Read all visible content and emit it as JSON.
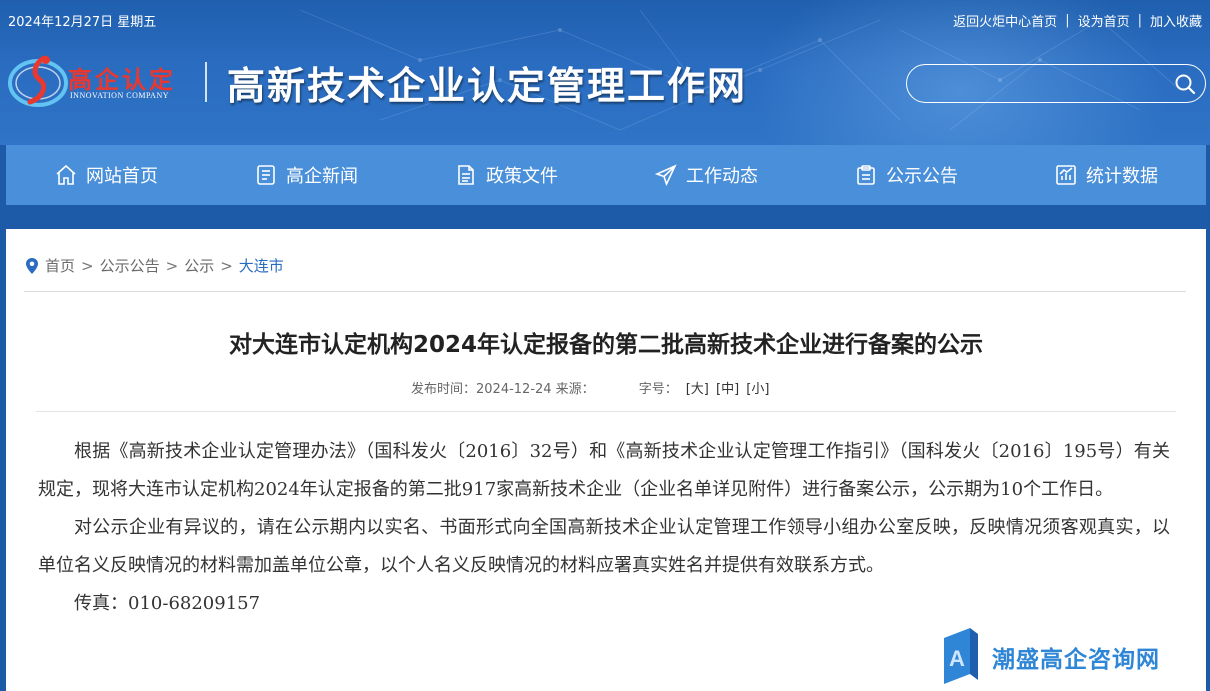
{
  "topbar": {
    "date": "2024年12月27日 星期五",
    "links": [
      "返回火炬中心首页",
      "设为首页",
      "加入收藏"
    ],
    "separator": "|"
  },
  "logo": {
    "cn": "高企认定",
    "en": "INNOVATION COMPANY"
  },
  "site_title": "高新技术企业认定管理工作网",
  "search": {
    "placeholder": ""
  },
  "nav": [
    {
      "label": "网站首页",
      "icon": "home-icon"
    },
    {
      "label": "高企新闻",
      "icon": "news-icon"
    },
    {
      "label": "政策文件",
      "icon": "document-icon"
    },
    {
      "label": "工作动态",
      "icon": "paper-plane-icon"
    },
    {
      "label": "公示公告",
      "icon": "clipboard-icon"
    },
    {
      "label": "统计数据",
      "icon": "chart-icon"
    }
  ],
  "breadcrumb": {
    "items": [
      "首页",
      "公示公告",
      "公示",
      "大连市"
    ],
    "separator": ">"
  },
  "article": {
    "title": "对大连市认定机构2024年认定报备的第二批高新技术企业进行备案的公示",
    "meta_date_label": "发布时间：2024-12-24 来源：",
    "font_size_label": "字号：",
    "font_sizes": [
      "[大]",
      "[中]",
      "[小]"
    ],
    "paragraphs": [
      "根据《高新技术企业认定管理办法》（国科发火〔2016〕32号）和《高新技术企业认定管理工作指引》（国科发火〔2016〕195号）有关规定，现将大连市认定机构2024年认定报备的第二批917家高新技术企业（企业名单详见附件）进行备案公示，公示期为10个工作日。",
      "对公示企业有异议的，请在公示期内以实名、书面形式向全国高新技术企业认定管理工作领导小组办公室反映，反映情况须客观真实，以单位名义反映情况的材料需加盖单位公章，以个人名义反映情况的材料应署真实姓名并提供有效联系方式。",
      "传真：010-68209157"
    ]
  },
  "watermark": {
    "text": "潮盛高企咨询网"
  },
  "colors": {
    "header_blue": "#2a6cc0",
    "nav_blue": "#4a8fd9",
    "logo_red": "#e8382f",
    "breadcrumb_current": "#2a6cc0",
    "watermark_blue": "#2f86d6"
  }
}
